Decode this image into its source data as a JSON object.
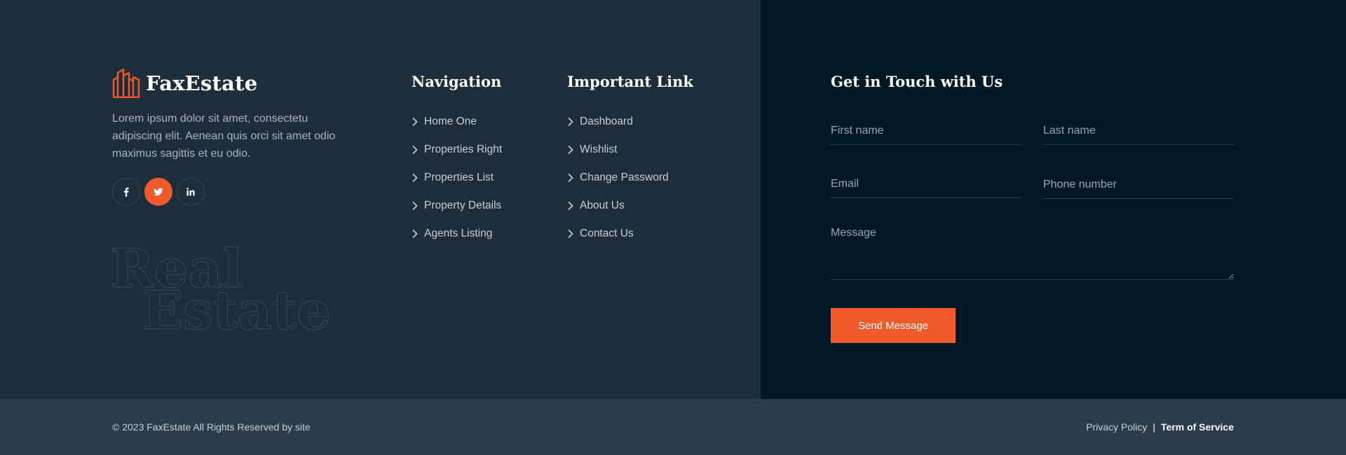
{
  "brand": {
    "name": "FaxEstate",
    "description": "Lorem ipsum dolor sit amet, consectetu adipiscing elit. Aenean quis orci sit amet odio maximus sagittis et eu odio.",
    "accent_color": "#f15a2b"
  },
  "socials": [
    {
      "icon": "facebook-icon",
      "active": false
    },
    {
      "icon": "twitter-icon",
      "active": true
    },
    {
      "icon": "linkedin-icon",
      "active": false
    }
  ],
  "watermark": {
    "line1": "Real",
    "line2": "Estate"
  },
  "navigation": {
    "title": "Navigation",
    "items": [
      "Home One",
      "Properties Right",
      "Properties List",
      "Property Details",
      "Agents Listing"
    ]
  },
  "important": {
    "title": "Important Link",
    "items": [
      "Dashboard",
      "Wishlist",
      "Change Password",
      "About Us",
      "Contact Us"
    ]
  },
  "contact": {
    "title": "Get in Touch with Us",
    "first_name_placeholder": "First name",
    "last_name_placeholder": "Last name",
    "email_placeholder": "Email",
    "phone_placeholder": "Phone number",
    "message_placeholder": "Message",
    "submit_label": "Send Message"
  },
  "footer": {
    "copyright": "© 2023 FaxEstate  All Rights Reserved by site",
    "privacy": "Privacy Policy",
    "separator": "|",
    "terms": "Term of Service"
  }
}
